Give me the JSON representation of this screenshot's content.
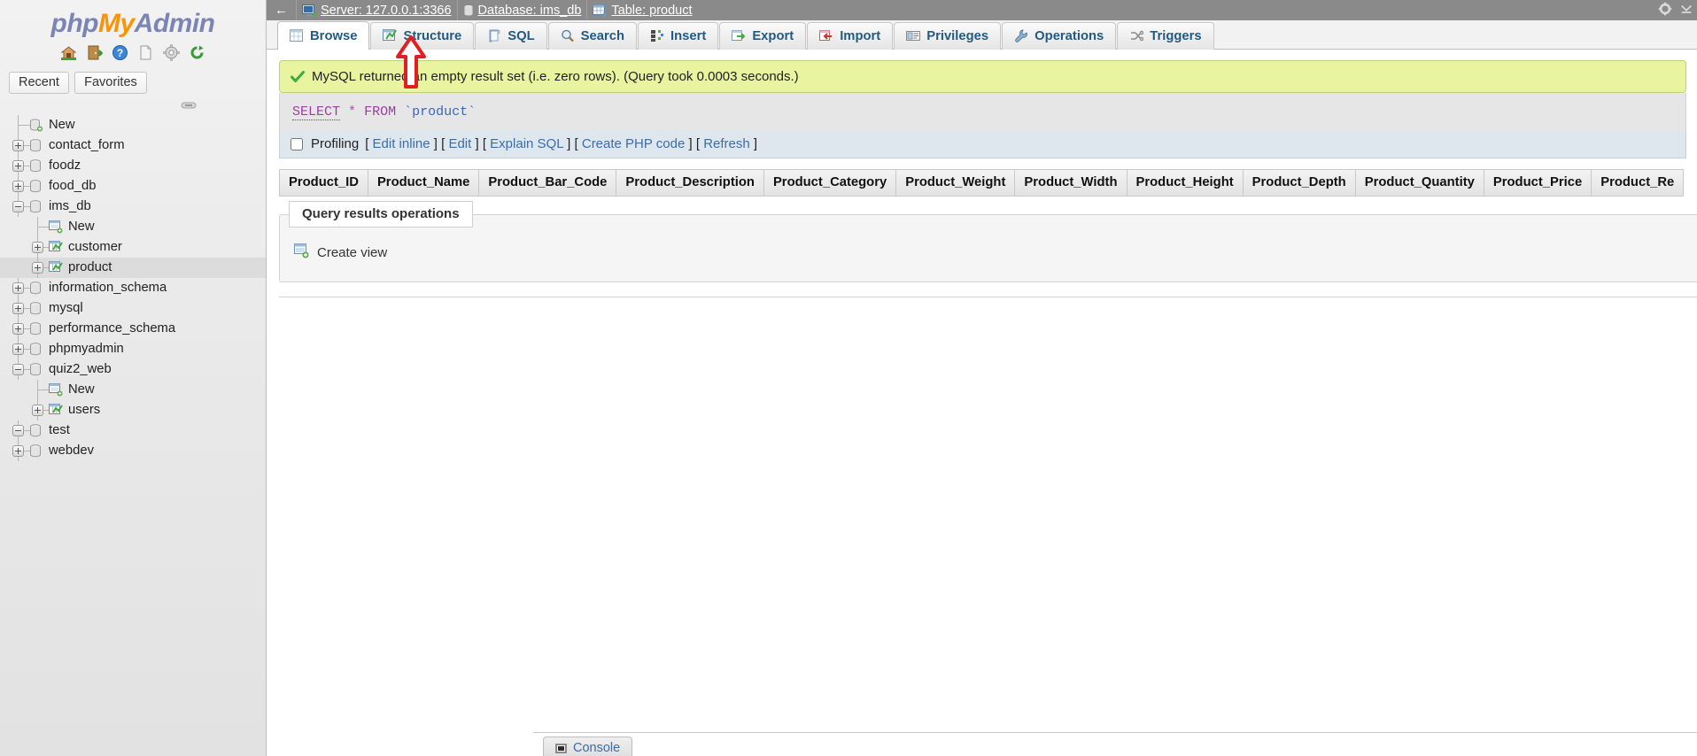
{
  "app": {
    "logo_php": "php",
    "logo_my": "My",
    "logo_admin": "Admin"
  },
  "sidebar": {
    "nav_icons": [
      "home-icon",
      "logout-icon",
      "help-icon",
      "docs-icon",
      "settings-icon",
      "reload-icon"
    ],
    "quick_buttons": [
      {
        "label": "Recent",
        "name": "recent-button"
      },
      {
        "label": "Favorites",
        "name": "favorites-button"
      }
    ],
    "tree": [
      {
        "label": "New",
        "type": "new-db",
        "depth": 0,
        "toggle": "none",
        "selected": false
      },
      {
        "label": "contact_form",
        "type": "db",
        "depth": 0,
        "toggle": "plus",
        "selected": false
      },
      {
        "label": "foodz",
        "type": "db",
        "depth": 0,
        "toggle": "plus",
        "selected": false
      },
      {
        "label": "food_db",
        "type": "db",
        "depth": 0,
        "toggle": "plus",
        "selected": false
      },
      {
        "label": "ims_db",
        "type": "db",
        "depth": 0,
        "toggle": "minus",
        "selected": false
      },
      {
        "label": "New",
        "type": "new-table",
        "depth": 1,
        "toggle": "none",
        "selected": false
      },
      {
        "label": "customer",
        "type": "table",
        "depth": 1,
        "toggle": "plus",
        "selected": false
      },
      {
        "label": "product",
        "type": "table",
        "depth": 1,
        "toggle": "plus",
        "selected": true
      },
      {
        "label": "information_schema",
        "type": "db",
        "depth": 0,
        "toggle": "plus",
        "selected": false
      },
      {
        "label": "mysql",
        "type": "db",
        "depth": 0,
        "toggle": "plus",
        "selected": false
      },
      {
        "label": "performance_schema",
        "type": "db",
        "depth": 0,
        "toggle": "plus",
        "selected": false
      },
      {
        "label": "phpmyadmin",
        "type": "db",
        "depth": 0,
        "toggle": "plus",
        "selected": false
      },
      {
        "label": "quiz2_web",
        "type": "db",
        "depth": 0,
        "toggle": "minus",
        "selected": false
      },
      {
        "label": "New",
        "type": "new-table",
        "depth": 1,
        "toggle": "none",
        "selected": false
      },
      {
        "label": "users",
        "type": "table",
        "depth": 1,
        "toggle": "plus",
        "selected": false
      },
      {
        "label": "test",
        "type": "db",
        "depth": 0,
        "toggle": "minus",
        "selected": false
      },
      {
        "label": "webdev",
        "type": "db",
        "depth": 0,
        "toggle": "plus",
        "selected": false
      }
    ]
  },
  "breadcrumb": {
    "back_label": "←",
    "server": "Server: 127.0.0.1:3366",
    "database": "Database: ims_db",
    "table": "Table: product",
    "separator": "»"
  },
  "tabs": [
    {
      "label": "Browse",
      "icon": "browse-icon",
      "active": true
    },
    {
      "label": "Structure",
      "icon": "structure-icon",
      "active": false
    },
    {
      "label": "SQL",
      "icon": "sql-icon",
      "active": false
    },
    {
      "label": "Search",
      "icon": "search-icon",
      "active": false
    },
    {
      "label": "Insert",
      "icon": "insert-icon",
      "active": false
    },
    {
      "label": "Export",
      "icon": "export-icon",
      "active": false
    },
    {
      "label": "Import",
      "icon": "import-icon",
      "active": false
    },
    {
      "label": "Privileges",
      "icon": "privileges-icon",
      "active": false
    },
    {
      "label": "Operations",
      "icon": "operations-icon",
      "active": false
    },
    {
      "label": "Triggers",
      "icon": "triggers-icon",
      "active": false
    }
  ],
  "result": {
    "success_message": "MySQL returned an empty result set (i.e. zero rows). (Query took 0.0003 seconds.)",
    "sql": {
      "select": "SELECT",
      "star": "*",
      "from": "FROM",
      "table": "`product`"
    },
    "profiling_label": "Profiling",
    "actions": [
      {
        "label": "Edit inline",
        "name": "edit-inline-link"
      },
      {
        "label": "Edit",
        "name": "edit-link"
      },
      {
        "label": "Explain SQL",
        "name": "explain-sql-link"
      },
      {
        "label": "Create PHP code",
        "name": "create-php-code-link"
      },
      {
        "label": "Refresh",
        "name": "refresh-link"
      }
    ],
    "columns": [
      "Product_ID",
      "Product_Name",
      "Product_Bar_Code",
      "Product_Description",
      "Product_Category",
      "Product_Weight",
      "Product_Width",
      "Product_Height",
      "Product_Depth",
      "Product_Quantity",
      "Product_Price",
      "Product_Re"
    ]
  },
  "operations": {
    "legend": "Query results operations",
    "create_view": "Create view"
  },
  "console": {
    "label": "Console"
  },
  "colors": {
    "accent": "#235a81",
    "logo_blue": "#7a85b5",
    "logo_orange": "#f89406",
    "success_bg": "#e8f4a0",
    "link": "#3a6ea5",
    "annotation_red": "#e02020"
  }
}
